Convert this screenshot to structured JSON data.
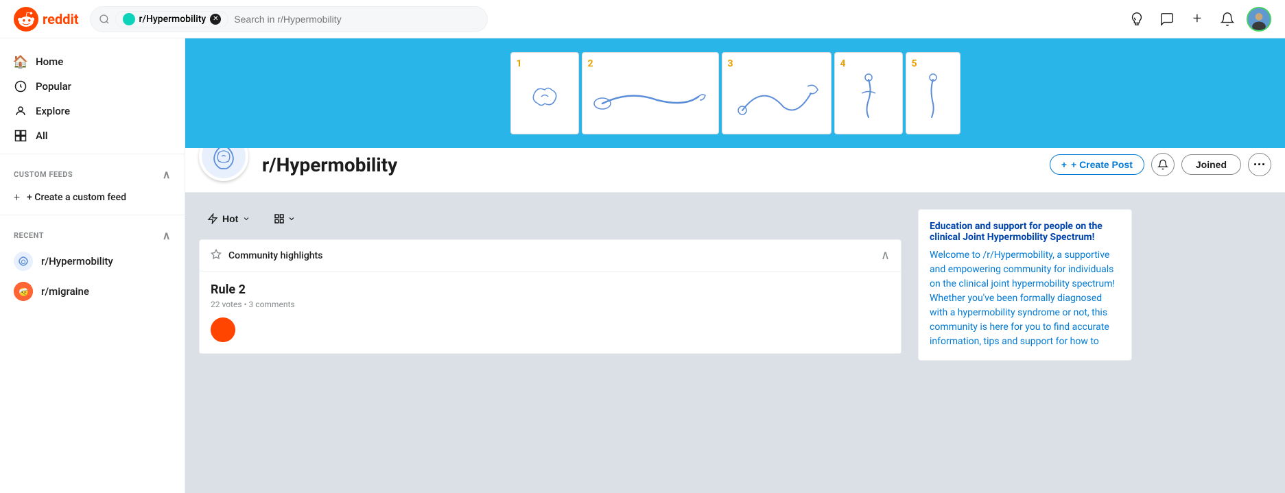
{
  "logo": {
    "text": "reddit"
  },
  "search": {
    "subreddit_tag": "r/Hypermobility",
    "placeholder": "Search in r/Hypermobility"
  },
  "nav_icons": {
    "awards": "🏆",
    "chat": "💬",
    "create": "+",
    "bell": "🔔"
  },
  "sidebar": {
    "items": [
      {
        "label": "Home",
        "icon": "🏠"
      },
      {
        "label": "Popular",
        "icon": "⬆"
      },
      {
        "label": "Explore",
        "icon": "👤"
      },
      {
        "label": "All",
        "icon": "📊"
      }
    ],
    "custom_feeds_label": "CUSTOM FEEDS",
    "create_feed_label": "+ Create a custom feed",
    "recent_label": "RECENT",
    "recent_subs": [
      {
        "name": "r/Hypermobility",
        "color": "#0dd3bb"
      },
      {
        "name": "r/migraine",
        "color": "#ff4500"
      }
    ]
  },
  "subreddit": {
    "name": "r/Hypermobility",
    "banner_bg": "#29b5e8"
  },
  "header_actions": {
    "create_post": "+ Create Post",
    "joined": "Joined",
    "more": "···"
  },
  "feed": {
    "sort_label": "Hot",
    "layout_label": "⊟"
  },
  "community_highlights": {
    "title": "Community highlights",
    "pin_icon": "📌"
  },
  "rule_card": {
    "title": "Rule 2",
    "votes": "22",
    "votes_label": "votes",
    "comments": "3",
    "comments_label": "comments"
  },
  "widget": {
    "title": "Education and support for people on the clinical Joint Hypermobility Spectrum!",
    "description": "Welcome to /r/Hypermobility, a supportive and empowering community for individuals on the clinical joint hypermobility spectrum! Whether you've been formally diagnosed with a hypermobility syndrome or not, this community is here for you to find accurate information, tips and support for how to"
  },
  "banner_cards": [
    {
      "number": "1"
    },
    {
      "number": "2"
    },
    {
      "number": "3"
    },
    {
      "number": "4"
    },
    {
      "number": "5"
    }
  ]
}
